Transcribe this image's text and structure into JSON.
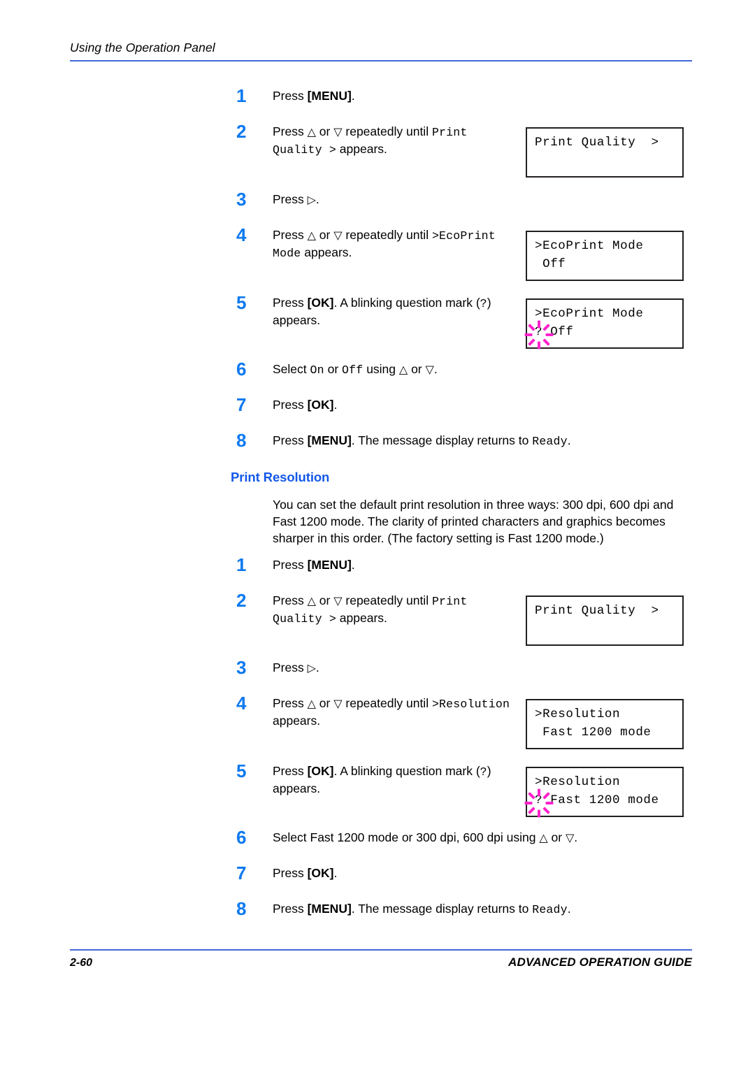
{
  "header": {
    "title": "Using the Operation Panel",
    "rule_color": "#4169D8"
  },
  "colors": {
    "step_number": "#0E79F0",
    "section_heading": "#1358E8",
    "rule": "#4169D8",
    "blink": "#FF22CC",
    "lcd_border": "#231f20"
  },
  "glyphs": {
    "up": "△",
    "down": "▽",
    "right": "▷"
  },
  "ecoprint": {
    "steps": [
      {
        "num": "1",
        "parts": [
          {
            "t": "Press ",
            "s": "plain"
          },
          {
            "t": "[MENU]",
            "s": "bold"
          },
          {
            "t": ".",
            "s": "plain"
          }
        ]
      },
      {
        "num": "2",
        "parts": [
          {
            "t": "Press ",
            "s": "plain"
          },
          {
            "t": "△",
            "s": "tri"
          },
          {
            "t": " or ",
            "s": "plain"
          },
          {
            "t": "▽",
            "s": "tri"
          },
          {
            "t": " repeatedly until ",
            "s": "plain"
          },
          {
            "t": "Print Quality >",
            "s": "mono"
          },
          {
            "t": " appears.",
            "s": "plain"
          }
        ]
      },
      {
        "num": "3",
        "parts": [
          {
            "t": "Press ",
            "s": "plain"
          },
          {
            "t": "▷",
            "s": "tri"
          },
          {
            "t": ".",
            "s": "plain"
          }
        ]
      },
      {
        "num": "4",
        "parts": [
          {
            "t": "Press ",
            "s": "plain"
          },
          {
            "t": "△",
            "s": "tri"
          },
          {
            "t": " or ",
            "s": "plain"
          },
          {
            "t": "▽",
            "s": "tri"
          },
          {
            "t": " repeatedly until ",
            "s": "plain"
          },
          {
            "t": ">EcoPrint Mode",
            "s": "mono"
          },
          {
            "t": " appears.",
            "s": "plain"
          }
        ]
      },
      {
        "num": "5",
        "parts": [
          {
            "t": "Press ",
            "s": "plain"
          },
          {
            "t": "[OK]",
            "s": "bold"
          },
          {
            "t": ". A blinking question mark (",
            "s": "plain"
          },
          {
            "t": "?",
            "s": "mono"
          },
          {
            "t": ") appears.",
            "s": "plain"
          }
        ]
      },
      {
        "num": "6",
        "parts": [
          {
            "t": "Select ",
            "s": "plain"
          },
          {
            "t": "On",
            "s": "mono"
          },
          {
            "t": " or ",
            "s": "plain"
          },
          {
            "t": "Off",
            "s": "mono"
          },
          {
            "t": " using ",
            "s": "plain"
          },
          {
            "t": "△",
            "s": "tri"
          },
          {
            "t": " or ",
            "s": "plain"
          },
          {
            "t": "▽",
            "s": "tri"
          },
          {
            "t": ".",
            "s": "plain"
          }
        ]
      },
      {
        "num": "7",
        "parts": [
          {
            "t": "Press ",
            "s": "plain"
          },
          {
            "t": "[OK]",
            "s": "bold"
          },
          {
            "t": ".",
            "s": "plain"
          }
        ]
      },
      {
        "num": "8",
        "parts": [
          {
            "t": "Press ",
            "s": "plain"
          },
          {
            "t": "[MENU]",
            "s": "bold"
          },
          {
            "t": ". The message display returns to ",
            "s": "plain"
          },
          {
            "t": "Ready",
            "s": "mono"
          },
          {
            "t": ".",
            "s": "plain"
          }
        ]
      }
    ],
    "displays": [
      {
        "line1": "Print Quality  >",
        "line2": "",
        "blink": false
      },
      {
        "line1": ">EcoPrint Mode",
        "line2": " Off",
        "blink": false
      },
      {
        "line1": ">EcoPrint Mode",
        "line2": "? Off",
        "blink": true
      }
    ]
  },
  "print_resolution": {
    "heading": "Print Resolution",
    "paragraph": "You can set the default print resolution in three ways: 300 dpi, 600 dpi and Fast 1200 mode. The clarity of printed characters and graphics becomes sharper in this order. (The factory setting is Fast 1200 mode.)",
    "steps": [
      {
        "num": "1",
        "parts": [
          {
            "t": "Press ",
            "s": "plain"
          },
          {
            "t": "[MENU]",
            "s": "bold"
          },
          {
            "t": ".",
            "s": "plain"
          }
        ]
      },
      {
        "num": "2",
        "parts": [
          {
            "t": "Press ",
            "s": "plain"
          },
          {
            "t": "△",
            "s": "tri"
          },
          {
            "t": " or ",
            "s": "plain"
          },
          {
            "t": "▽",
            "s": "tri"
          },
          {
            "t": " repeatedly until ",
            "s": "plain"
          },
          {
            "t": "Print Quality >",
            "s": "mono"
          },
          {
            "t": " appears.",
            "s": "plain"
          }
        ]
      },
      {
        "num": "3",
        "parts": [
          {
            "t": "Press ",
            "s": "plain"
          },
          {
            "t": "▷",
            "s": "tri"
          },
          {
            "t": ".",
            "s": "plain"
          }
        ]
      },
      {
        "num": "4",
        "parts": [
          {
            "t": "Press ",
            "s": "plain"
          },
          {
            "t": "△",
            "s": "tri"
          },
          {
            "t": " or ",
            "s": "plain"
          },
          {
            "t": "▽",
            "s": "tri"
          },
          {
            "t": " repeatedly until ",
            "s": "plain"
          },
          {
            "t": ">Resolution",
            "s": "mono"
          },
          {
            "t": " appears.",
            "s": "plain"
          }
        ]
      },
      {
        "num": "5",
        "parts": [
          {
            "t": "Press ",
            "s": "plain"
          },
          {
            "t": "[OK]",
            "s": "bold"
          },
          {
            "t": ". A blinking question mark (",
            "s": "plain"
          },
          {
            "t": "?",
            "s": "mono"
          },
          {
            "t": ") appears.",
            "s": "plain"
          }
        ]
      },
      {
        "num": "6",
        "parts": [
          {
            "t": "Select Fast 1200 mode or 300 dpi, 600 dpi using ",
            "s": "plain"
          },
          {
            "t": "△",
            "s": "tri"
          },
          {
            "t": " or ",
            "s": "plain"
          },
          {
            "t": "▽",
            "s": "tri"
          },
          {
            "t": ".",
            "s": "plain"
          }
        ]
      },
      {
        "num": "7",
        "parts": [
          {
            "t": "Press ",
            "s": "plain"
          },
          {
            "t": "[OK]",
            "s": "bold"
          },
          {
            "t": ".",
            "s": "plain"
          }
        ]
      },
      {
        "num": "8",
        "parts": [
          {
            "t": "Press ",
            "s": "plain"
          },
          {
            "t": "[MENU]",
            "s": "bold"
          },
          {
            "t": ". The message display returns to ",
            "s": "plain"
          },
          {
            "t": "Ready",
            "s": "mono"
          },
          {
            "t": ".",
            "s": "plain"
          }
        ]
      }
    ],
    "displays": [
      {
        "line1": "Print Quality  >",
        "line2": "",
        "blink": false
      },
      {
        "line1": ">Resolution",
        "line2": " Fast 1200 mode",
        "blink": false
      },
      {
        "line1": ">Resolution",
        "line2": "? Fast 1200 mode",
        "blink": true
      }
    ]
  },
  "footer": {
    "page_number": "2-60",
    "guide_title": "ADVANCED OPERATION GUIDE"
  }
}
